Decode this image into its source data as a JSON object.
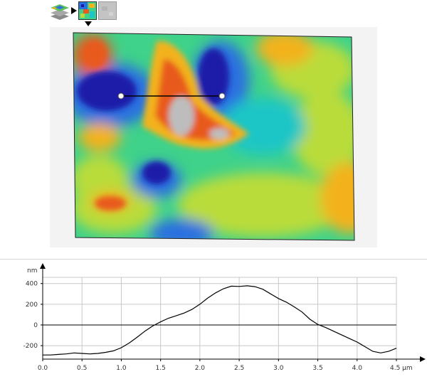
{
  "colors": {
    "scale": [
      "#1a1aa8",
      "#2a6fe0",
      "#1bc6c6",
      "#3fd28a",
      "#b9dc3a",
      "#f3b21c",
      "#e85a1e",
      "#bdbdbd"
    ],
    "profile_line": "#000000",
    "grid": "#c8c8c8",
    "panel": "#f3f3f3"
  },
  "icons": {
    "stack": "layers-stack-icon",
    "arrow": "right-arrow-icon",
    "color_view": "color-map-thumbnail",
    "gray_view": "grayscale-thumbnail",
    "selected": "triangle-down-icon"
  },
  "chart_data": {
    "type": "line",
    "title": "",
    "xlabel": "",
    "ylabel": "nm",
    "x_unit": "µm",
    "xlim": [
      0,
      4.5
    ],
    "ylim": [
      -330,
      460
    ],
    "x_ticks": [
      0.0,
      0.5,
      1.0,
      1.5,
      2.0,
      2.5,
      3.0,
      3.5,
      4.0,
      4.5
    ],
    "x_tick_labels": [
      "0.0",
      "0.5",
      "1.0",
      "1.5",
      "2.0",
      "2.5",
      "3.0",
      "3.5",
      "4.0",
      "4.5 µm"
    ],
    "y_ticks": [
      -200,
      0,
      200,
      400
    ],
    "y_tick_labels": [
      "-200",
      "0",
      "200",
      "400"
    ],
    "grid": true,
    "series": [
      {
        "x": [
          0.0,
          0.1,
          0.2,
          0.3,
          0.4,
          0.5,
          0.6,
          0.7,
          0.8,
          0.9,
          1.0,
          1.1,
          1.2,
          1.3,
          1.4,
          1.5,
          1.6,
          1.7,
          1.8,
          1.9,
          2.0,
          2.1,
          2.2,
          2.3,
          2.4,
          2.5,
          2.6,
          2.7,
          2.8,
          2.9,
          3.0,
          3.1,
          3.2,
          3.3,
          3.4,
          3.5,
          3.6,
          3.7,
          3.8,
          3.9,
          4.0,
          4.1,
          4.2,
          4.3,
          4.4,
          4.5
        ],
        "y": [
          -290,
          -290,
          -285,
          -280,
          -270,
          -275,
          -280,
          -275,
          -265,
          -250,
          -220,
          -175,
          -120,
          -60,
          -10,
          30,
          65,
          90,
          115,
          150,
          200,
          260,
          310,
          350,
          375,
          372,
          378,
          370,
          345,
          300,
          255,
          220,
          175,
          125,
          55,
          5,
          -25,
          -60,
          -95,
          -130,
          -165,
          -210,
          -255,
          -270,
          -255,
          -225
        ]
      }
    ]
  }
}
